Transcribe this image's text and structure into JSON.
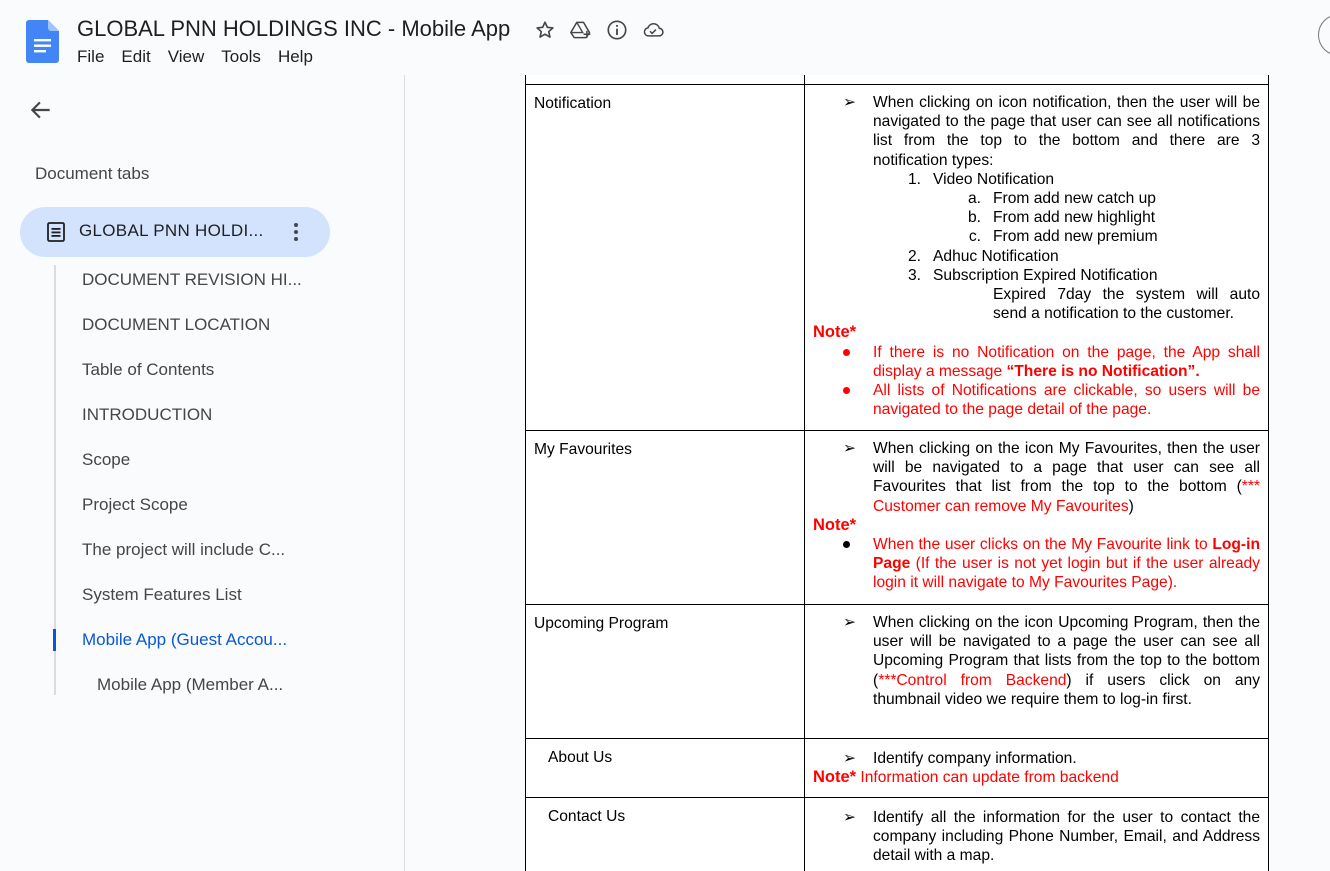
{
  "app": {
    "title": "GLOBAL PNN HOLDINGS INC - Mobile App",
    "menu": [
      "File",
      "Edit",
      "View",
      "Tools",
      "Help"
    ],
    "icons": [
      "star-icon",
      "move-to-drive-icon",
      "info-icon",
      "cloud-saved-icon"
    ],
    "accent": "#0b57d0",
    "tab_highlight": "#d3e3fd"
  },
  "sidebar": {
    "heading": "Document tabs",
    "active_tab": "GLOBAL PNN HOLDI...",
    "outline": [
      {
        "label": "DOCUMENT REVISION HI...",
        "level": 1,
        "active": false
      },
      {
        "label": "DOCUMENT LOCATION",
        "level": 1,
        "active": false
      },
      {
        "label": "Table of Contents",
        "level": 1,
        "active": false
      },
      {
        "label": "INTRODUCTION",
        "level": 1,
        "active": false
      },
      {
        "label": "Scope",
        "level": 1,
        "active": false
      },
      {
        "label": "Project Scope",
        "level": 1,
        "active": false
      },
      {
        "label": "The project will include C...",
        "level": 1,
        "active": false
      },
      {
        "label": "System Features List",
        "level": 1,
        "active": false
      },
      {
        "label": "Mobile App (Guest Accou...",
        "level": 1,
        "active": true
      },
      {
        "label": "Mobile App (Member A...",
        "level": 2,
        "active": false
      }
    ]
  },
  "doc": {
    "arrow": "➢",
    "note": "Note*",
    "rows": {
      "notification": {
        "feature": "Notification",
        "desc": "When clicking on icon notification, then the user will be navigated to the page that user can see all notifications list from the top to the bottom and there are 3 notification types:",
        "types": [
          {
            "n": "1.",
            "label": "Video Notification"
          },
          {
            "n": "2.",
            "label": "Adhuc Notification"
          },
          {
            "n": "3.",
            "label": "Subscription Expired Notification"
          }
        ],
        "video_subs": [
          {
            "n": "a.",
            "label": "From add new catch up"
          },
          {
            "n": "b.",
            "label": "From add new highlight"
          },
          {
            "n": "c.",
            "label": "From add new premium"
          }
        ],
        "expired_text": "Expired 7day the system will auto send a notification to the customer.",
        "note_b1_pre": "If there is no Notification on the page, the App shall display a message ",
        "note_b1_bold": "“There is no Notification”.",
        "note_b2": "All lists of Notifications are clickable, so users will be navigated to the page detail of the page."
      },
      "favourites": {
        "feature": "My Favourites",
        "desc_pre": "When clicking on the icon My Favourites, then the user will be navigated to a page that user can see all Favourites that list from the top to the bottom (",
        "desc_red": "*** Customer can remove My Favourites",
        "desc_post": ")",
        "note_pre": "When the user clicks on the My Favourite link to ",
        "note_bold": "Log-in Page",
        "note_post": " (If the user is not yet login but if the user already login it will navigate to My Favourites Page)."
      },
      "upcoming": {
        "feature": "Upcoming Program",
        "desc_pre": "When clicking on the icon Upcoming Program, then the user will be navigated to a page the user can see all Upcoming Program that lists from the top to the bottom (",
        "desc_red": "***Control from Backend",
        "desc_post": ") if users click on any thumbnail video we require them to log-in first."
      },
      "about": {
        "feature": "About Us",
        "desc": "Identify company information.",
        "note_text": " Information can update from backend"
      },
      "contact": {
        "feature": "Contact Us",
        "desc": "Identify all the information for the user to contact the company including Phone Number, Email, and Address detail with a map."
      }
    }
  }
}
